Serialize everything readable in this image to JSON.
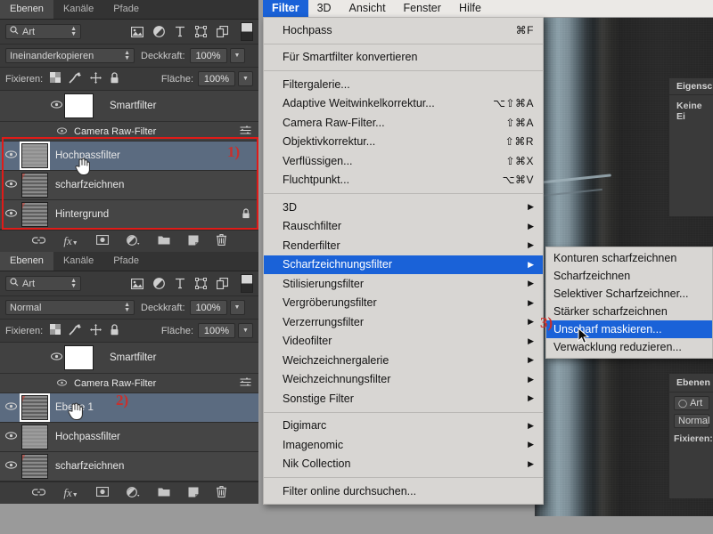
{
  "app": {
    "menubar": {
      "items": [
        {
          "label": "Filter",
          "active": true
        },
        {
          "label": "3D",
          "active": false
        },
        {
          "label": "Ansicht",
          "active": false
        },
        {
          "label": "Fenster",
          "active": false
        },
        {
          "label": "Hilfe",
          "active": false
        }
      ]
    },
    "colors": {
      "menu_highlight": "#1a62d8",
      "annotation_red": "#e01b18",
      "panel_bg": "#3a3a3a",
      "layer_selected": "#5b6b80",
      "menu_bg": "#d8d6d3"
    }
  },
  "filter_menu": {
    "groups": [
      [
        {
          "label": "Hochpass",
          "shortcut": "⌘F",
          "arrow": false,
          "highlighted": false
        }
      ],
      [
        {
          "label": "Für Smartfilter konvertieren",
          "shortcut": "",
          "arrow": false,
          "highlighted": false
        }
      ],
      [
        {
          "label": "Filtergalerie...",
          "shortcut": "",
          "arrow": false,
          "highlighted": false
        },
        {
          "label": "Adaptive Weitwinkelkorrektur...",
          "shortcut": "⌥⇧⌘A",
          "arrow": false,
          "highlighted": false
        },
        {
          "label": "Camera Raw-Filter...",
          "shortcut": "⇧⌘A",
          "arrow": false,
          "highlighted": false
        },
        {
          "label": "Objektivkorrektur...",
          "shortcut": "⇧⌘R",
          "arrow": false,
          "highlighted": false
        },
        {
          "label": "Verflüssigen...",
          "shortcut": "⇧⌘X",
          "arrow": false,
          "highlighted": false
        },
        {
          "label": "Fluchtpunkt...",
          "shortcut": "⌥⌘V",
          "arrow": false,
          "highlighted": false
        }
      ],
      [
        {
          "label": "3D",
          "shortcut": "",
          "arrow": true,
          "highlighted": false
        },
        {
          "label": "Rauschfilter",
          "shortcut": "",
          "arrow": true,
          "highlighted": false
        },
        {
          "label": "Renderfilter",
          "shortcut": "",
          "arrow": true,
          "highlighted": false
        },
        {
          "label": "Scharfzeichnungsfilter",
          "shortcut": "",
          "arrow": true,
          "highlighted": true
        },
        {
          "label": "Stilisierungsfilter",
          "shortcut": "",
          "arrow": true,
          "highlighted": false
        },
        {
          "label": "Vergröberungsfilter",
          "shortcut": "",
          "arrow": true,
          "highlighted": false
        },
        {
          "label": "Verzerrungsfilter",
          "shortcut": "",
          "arrow": true,
          "highlighted": false
        },
        {
          "label": "Videofilter",
          "shortcut": "",
          "arrow": true,
          "highlighted": false
        },
        {
          "label": "Weichzeichnergalerie",
          "shortcut": "",
          "arrow": true,
          "highlighted": false
        },
        {
          "label": "Weichzeichnungsfilter",
          "shortcut": "",
          "arrow": true,
          "highlighted": false
        },
        {
          "label": "Sonstige Filter",
          "shortcut": "",
          "arrow": true,
          "highlighted": false
        }
      ],
      [
        {
          "label": "Digimarc",
          "shortcut": "",
          "arrow": true,
          "highlighted": false
        },
        {
          "label": "Imagenomic",
          "shortcut": "",
          "arrow": true,
          "highlighted": false
        },
        {
          "label": "Nik Collection",
          "shortcut": "",
          "arrow": true,
          "highlighted": false
        }
      ],
      [
        {
          "label": "Filter online durchsuchen...",
          "shortcut": "",
          "arrow": false,
          "highlighted": false
        }
      ]
    ]
  },
  "submenu": {
    "parent": "Scharfzeichnungsfilter",
    "items": [
      {
        "label": "Konturen scharfzeichnen",
        "highlighted": false
      },
      {
        "label": "Scharfzeichnen",
        "highlighted": false
      },
      {
        "label": "Selektiver Scharfzeichner...",
        "highlighted": false
      },
      {
        "label": "Stärker scharfzeichnen",
        "highlighted": false
      },
      {
        "label": "Unscharf maskieren...",
        "highlighted": true
      },
      {
        "label": "Verwacklung reduzieren...",
        "highlighted": false
      }
    ]
  },
  "panel_top": {
    "tabs": [
      {
        "label": "Ebenen",
        "active": true
      },
      {
        "label": "Kanäle",
        "active": false
      },
      {
        "label": "Pfade",
        "active": false
      }
    ],
    "filter_select": "Art",
    "filter_icons": [
      "image-filter-icon",
      "adjustment-filter-icon",
      "type-filter-icon",
      "shape-filter-icon",
      "smartobject-filter-icon"
    ],
    "blend_mode": "Ineinanderkopieren",
    "opacity_label": "Deckkraft:",
    "opacity_value": "100%",
    "lock_label": "Fixieren:",
    "lock_icons": [
      "transparency-lock-icon",
      "image-lock-icon",
      "position-lock-icon",
      "all-lock-icon"
    ],
    "fill_label": "Fläche:",
    "fill_value": "100%",
    "smart_filter_label": "Smartfilter",
    "smart_sub_label": "Camera Raw-Filter",
    "layers": [
      {
        "name": "Hochpassfilter",
        "selected": true,
        "locked": false,
        "thumb": "gray"
      },
      {
        "name": "scharfzeichnen",
        "selected": false,
        "locked": false,
        "thumb": "photo"
      },
      {
        "name": "Hintergrund",
        "selected": false,
        "locked": true,
        "thumb": "photo"
      }
    ],
    "footer_icons": [
      "link-layers-icon",
      "layer-style-fx-icon",
      "layer-mask-icon",
      "adjustment-layer-icon",
      "new-group-icon",
      "new-layer-icon",
      "delete-layer-icon"
    ]
  },
  "panel_bottom": {
    "tabs": [
      {
        "label": "Ebenen",
        "active": true
      },
      {
        "label": "Kanäle",
        "active": false
      },
      {
        "label": "Pfade",
        "active": false
      }
    ],
    "filter_select": "Art",
    "blend_mode": "Normal",
    "opacity_label": "Deckkraft:",
    "opacity_value": "100%",
    "lock_label": "Fixieren:",
    "fill_label": "Fläche:",
    "fill_value": "100%",
    "smart_filter_label": "Smartfilter",
    "smart_sub_label": "Camera Raw-Filter",
    "layers": [
      {
        "name": "Ebene 1",
        "selected": true,
        "locked": false,
        "thumb": "photo"
      },
      {
        "name": "Hochpassfilter",
        "selected": false,
        "locked": false,
        "thumb": "gray"
      },
      {
        "name": "scharfzeichnen",
        "selected": false,
        "locked": false,
        "thumb": "photo"
      }
    ],
    "footer_icons": [
      "link-layers-icon",
      "layer-style-fx-icon",
      "layer-mask-icon",
      "adjustment-layer-icon",
      "new-group-icon",
      "new-layer-icon",
      "delete-layer-icon"
    ]
  },
  "right_dock": {
    "properties_title": "Eigensch",
    "properties_body": "Keine Ei",
    "layers_title": "Ebenen",
    "filter_select": "Art",
    "blend_mode": "Normal",
    "lock_label": "Fixieren:"
  },
  "annotations": [
    {
      "id": "1",
      "label": "1)"
    },
    {
      "id": "2",
      "label": "2)"
    },
    {
      "id": "3",
      "label": "3)"
    }
  ]
}
